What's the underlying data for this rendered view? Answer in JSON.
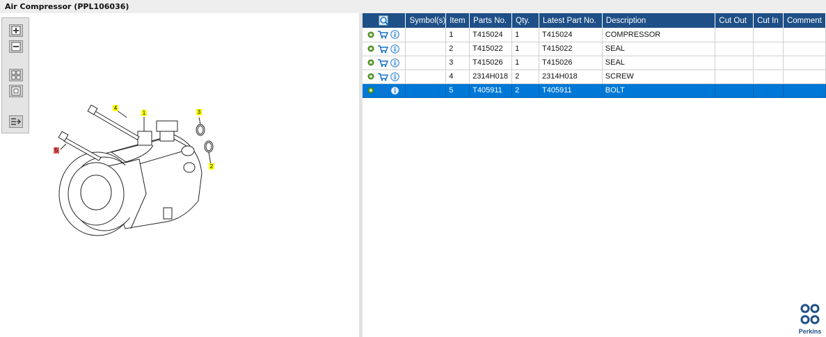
{
  "window": {
    "title": "Air Compressor (PPL106036)"
  },
  "toolbar": {
    "buttons": [
      "zoom-in-icon",
      "zoom-out-icon",
      "fit-all-icon",
      "actual-size-icon",
      "export-icon"
    ]
  },
  "drawing": {
    "callouts": [
      "1",
      "2",
      "3",
      "4",
      "5"
    ],
    "highlighted_callout": "5"
  },
  "table": {
    "headers": {
      "actions": "",
      "symbols": "Symbol(s)",
      "item": "Item",
      "parts_no": "Parts No.",
      "qty": "Qty.",
      "latest_part_no": "Latest Part No.",
      "description": "Description",
      "cut_out": "Cut Out",
      "cut_in": "Cut In",
      "comment": "Comment"
    },
    "rows": [
      {
        "symbols": "",
        "item": "1",
        "parts_no": "T415024",
        "qty": "1",
        "latest_part_no": "T415024",
        "description": "COMPRESSOR",
        "cut_out": "",
        "cut_in": "",
        "comment": ""
      },
      {
        "symbols": "",
        "item": "2",
        "parts_no": "T415022",
        "qty": "1",
        "latest_part_no": "T415022",
        "description": "SEAL",
        "cut_out": "",
        "cut_in": "",
        "comment": ""
      },
      {
        "symbols": "",
        "item": "3",
        "parts_no": "T415026",
        "qty": "1",
        "latest_part_no": "T415026",
        "description": "SEAL",
        "cut_out": "",
        "cut_in": "",
        "comment": ""
      },
      {
        "symbols": "",
        "item": "4",
        "parts_no": "2314H018",
        "qty": "2",
        "latest_part_no": "2314H018",
        "description": "SCREW",
        "cut_out": "",
        "cut_in": "",
        "comment": ""
      },
      {
        "symbols": "",
        "item": "5",
        "parts_no": "T405911",
        "qty": "2",
        "latest_part_no": "T405911",
        "description": "BOLT",
        "cut_out": "",
        "cut_in": "",
        "comment": ""
      }
    ],
    "selected_row": 4
  },
  "brand": {
    "logo_text": "Perkins"
  },
  "colors": {
    "header": "#1e4f86",
    "selection": "#0078d7",
    "callout": "#ffff00",
    "callout_selected": "#e55a5a"
  }
}
